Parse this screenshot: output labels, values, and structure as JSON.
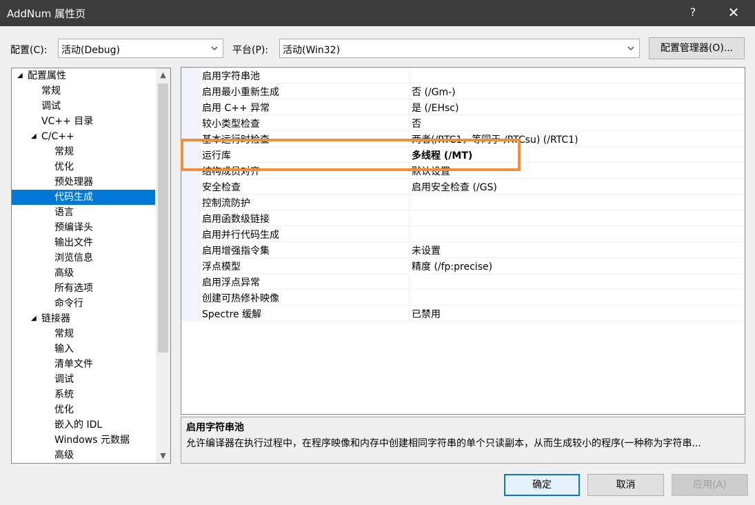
{
  "window": {
    "title": "AddNum 属性页",
    "help_label": "?",
    "close_label": "✕"
  },
  "config": {
    "label": "配置(C):",
    "value": "活动(Debug)"
  },
  "platform": {
    "label": "平台(P):",
    "value": "活动(Win32)"
  },
  "config_manager_label": "配置管理器(O)...",
  "tree": {
    "items": [
      {
        "label": "配置属性",
        "level": 0,
        "expanded": true
      },
      {
        "label": "常规",
        "level": 1
      },
      {
        "label": "调试",
        "level": 1
      },
      {
        "label": "VC++ 目录",
        "level": 1
      },
      {
        "label": "C/C++",
        "level": 1,
        "expanded": true
      },
      {
        "label": "常规",
        "level": 2
      },
      {
        "label": "优化",
        "level": 2
      },
      {
        "label": "预处理器",
        "level": 2
      },
      {
        "label": "代码生成",
        "level": 2,
        "selected": true
      },
      {
        "label": "语言",
        "level": 2
      },
      {
        "label": "预编译头",
        "level": 2
      },
      {
        "label": "输出文件",
        "level": 2
      },
      {
        "label": "浏览信息",
        "level": 2
      },
      {
        "label": "高级",
        "level": 2
      },
      {
        "label": "所有选项",
        "level": 2
      },
      {
        "label": "命令行",
        "level": 2
      },
      {
        "label": "链接器",
        "level": 1,
        "expanded": true
      },
      {
        "label": "常规",
        "level": 2
      },
      {
        "label": "输入",
        "level": 2
      },
      {
        "label": "清单文件",
        "level": 2
      },
      {
        "label": "调试",
        "level": 2
      },
      {
        "label": "系统",
        "level": 2
      },
      {
        "label": "优化",
        "level": 2
      },
      {
        "label": "嵌入的 IDL",
        "level": 2
      },
      {
        "label": "Windows 元数据",
        "level": 2
      },
      {
        "label": "高级",
        "level": 2
      }
    ]
  },
  "properties": [
    {
      "name": "启用字符串池",
      "value": ""
    },
    {
      "name": "启用最小重新生成",
      "value": "否 (/Gm-)"
    },
    {
      "name": "启用 C++ 异常",
      "value": "是 (/EHsc)"
    },
    {
      "name": "较小类型检查",
      "value": "否"
    },
    {
      "name": "基本运行时检查",
      "value": "两者(/RTC1，等同于 /RTCsu) (/RTC1)"
    },
    {
      "name": "运行库",
      "value": "多线程 (/MT)",
      "bold": true
    },
    {
      "name": "结构成员对齐",
      "value": "默认设置"
    },
    {
      "name": "安全检查",
      "value": "启用安全检查 (/GS)"
    },
    {
      "name": "控制流防护",
      "value": ""
    },
    {
      "name": "启用函数级链接",
      "value": ""
    },
    {
      "name": "启用并行代码生成",
      "value": ""
    },
    {
      "name": "启用增强指令集",
      "value": "未设置"
    },
    {
      "name": "浮点模型",
      "value": "精度 (/fp:precise)"
    },
    {
      "name": "启用浮点异常",
      "value": ""
    },
    {
      "name": "创建可热修补映像",
      "value": ""
    },
    {
      "name": "Spectre 缓解",
      "value": "已禁用"
    }
  ],
  "description": {
    "title": "启用字符串池",
    "text": "允许编译器在执行过程中，在程序映像和内存中创建相同字符串的单个只读副本，从而生成较小的程序(一种称为字符串..."
  },
  "buttons": {
    "ok": "确定",
    "cancel": "取消",
    "apply": "应用(A)"
  },
  "colors": {
    "titlebar": "#3c3c3c",
    "selection": "#0078d7",
    "highlight_box": "#f0903a"
  }
}
